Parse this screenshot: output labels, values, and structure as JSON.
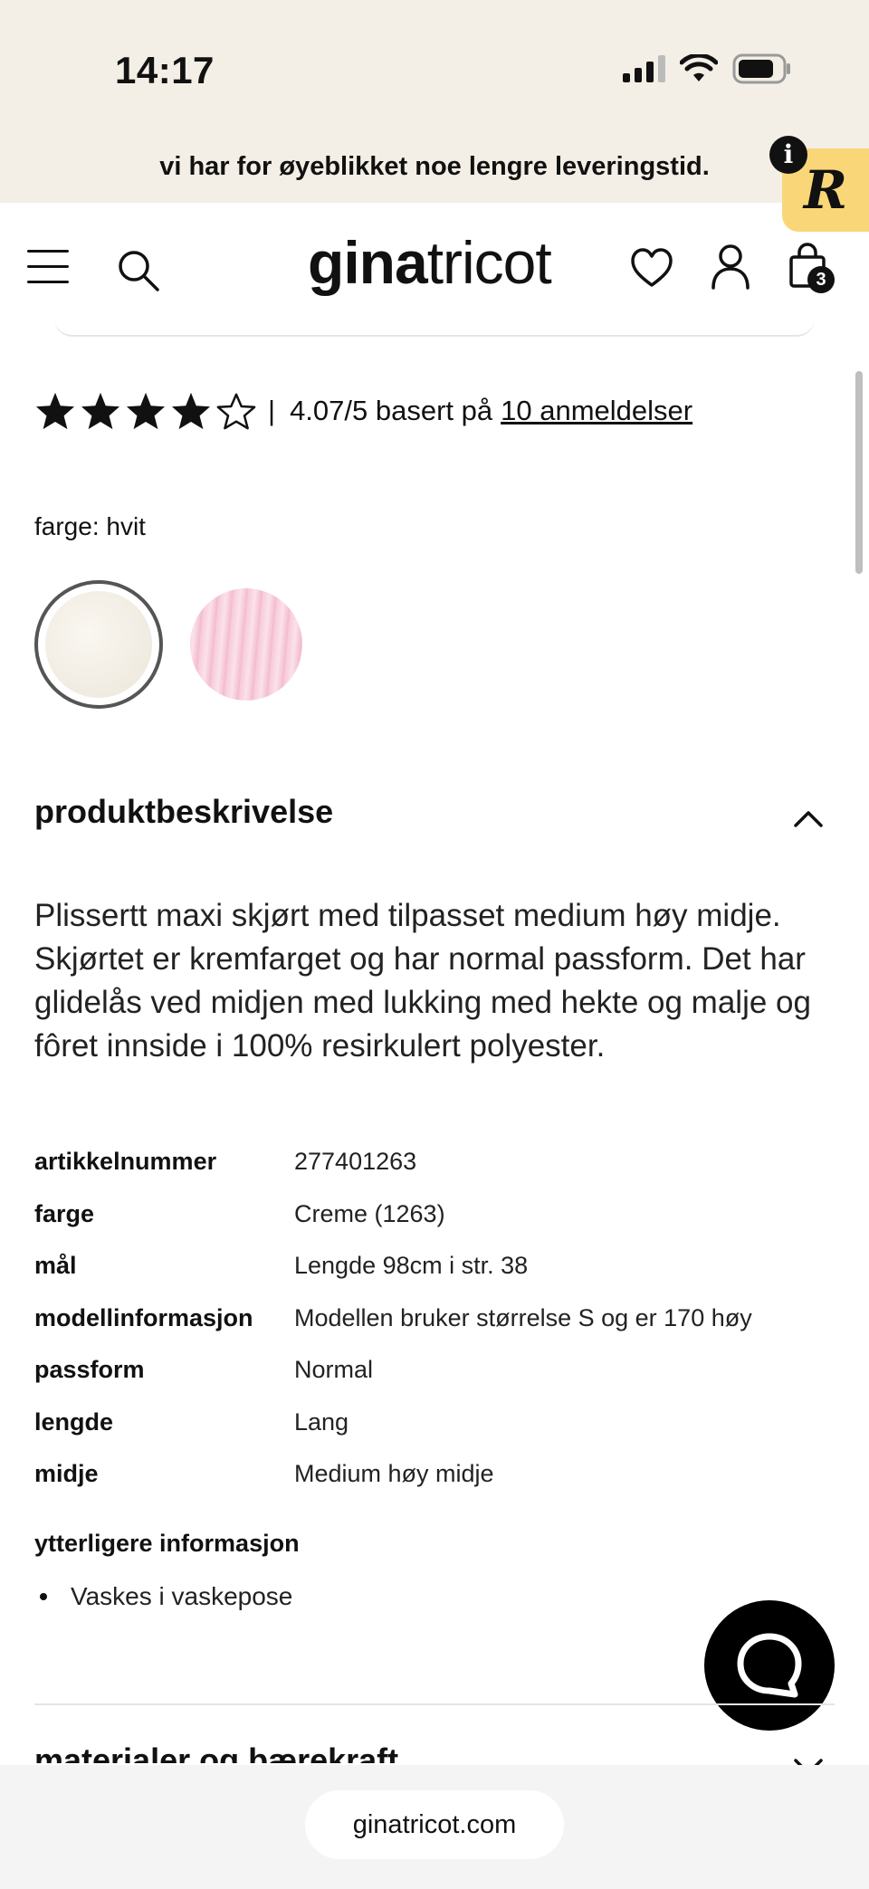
{
  "status_bar": {
    "time": "14:17"
  },
  "banner": {
    "text": "vi har for øyeblikket noe lengre leveringstid.",
    "info_label": "i",
    "badge_label": "R"
  },
  "header": {
    "logo_bold": "gina",
    "logo_light": "tricot",
    "cart_count": "3"
  },
  "rating": {
    "stars_filled": 4,
    "stars_total": 5,
    "separator": "|",
    "text": "4.07/5 basert på",
    "link": "10 anmeldelser"
  },
  "color": {
    "label": "farge: hvit",
    "swatches": [
      {
        "name": "hvit",
        "selected": true,
        "color": "#f5f1ea"
      },
      {
        "name": "rosa",
        "selected": false,
        "color": "#f7c9d8"
      }
    ]
  },
  "description": {
    "title": "produktbeskrivelse",
    "text": "Plissertt maxi skjørt med tilpasset medium høy midje. Skjørtet er kremfarget og har normal passform. Det har glidelås ved midjen med lukking med hekte og malje og fôret innside i 100% resirkulert polyester.",
    "specs": [
      {
        "key": "artikkelnummer",
        "value": "277401263"
      },
      {
        "key": "farge",
        "value": "Creme (1263)"
      },
      {
        "key": "mål",
        "value": "Lengde 98cm i str. 38"
      },
      {
        "key": "modellinformasjon",
        "value": "Modellen bruker størrelse S og er 170 høy"
      },
      {
        "key": "passform",
        "value": "Normal"
      },
      {
        "key": "lengde",
        "value": "Lang"
      },
      {
        "key": "midje",
        "value": "Medium høy midje"
      }
    ],
    "more_info_title": "ytterligere informasjon",
    "more_info_items": [
      "Vaskes i vaskepose"
    ]
  },
  "next_section": {
    "title": "materialer og bærekraft"
  },
  "browser": {
    "url": "ginatricot.com"
  }
}
